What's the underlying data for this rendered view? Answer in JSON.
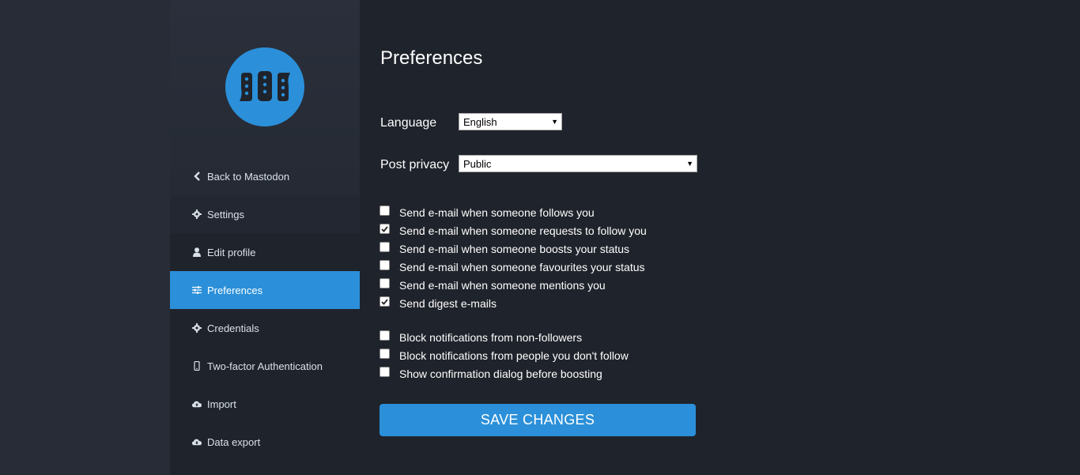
{
  "page": {
    "title": "Preferences"
  },
  "sidebar": {
    "logo_icon": "mastodon-logo-icon",
    "items": [
      {
        "label": "Back to Mastodon",
        "icon": "chevron-left-icon",
        "active": false
      },
      {
        "label": "Settings",
        "icon": "gear-icon",
        "active": false
      },
      {
        "label": "Edit profile",
        "icon": "user-icon",
        "active": false
      },
      {
        "label": "Preferences",
        "icon": "sliders-icon",
        "active": true
      },
      {
        "label": "Credentials",
        "icon": "gear-icon",
        "active": false
      },
      {
        "label": "Two-factor Authentication",
        "icon": "mobile-icon",
        "active": false
      },
      {
        "label": "Import",
        "icon": "cloud-upload-icon",
        "active": false
      },
      {
        "label": "Data export",
        "icon": "cloud-download-icon",
        "active": false
      }
    ]
  },
  "form": {
    "language": {
      "label": "Language",
      "value": "English"
    },
    "post_privacy": {
      "label": "Post privacy",
      "value": "Public"
    },
    "email_checks": [
      {
        "label": "Send e-mail when someone follows you",
        "checked": false
      },
      {
        "label": "Send e-mail when someone requests to follow you",
        "checked": true
      },
      {
        "label": "Send e-mail when someone boosts your status",
        "checked": false
      },
      {
        "label": "Send e-mail when someone favourites your status",
        "checked": false
      },
      {
        "label": "Send e-mail when someone mentions you",
        "checked": false
      },
      {
        "label": "Send digest e-mails",
        "checked": true
      }
    ],
    "other_checks": [
      {
        "label": "Block notifications from non-followers",
        "checked": false
      },
      {
        "label": "Block notifications from people you don't follow",
        "checked": false
      },
      {
        "label": "Show confirmation dialog before boosting",
        "checked": false
      }
    ],
    "save_label": "SAVE CHANGES"
  },
  "colors": {
    "accent": "#2b90d9",
    "sidebar_bg": "#282c37",
    "content_bg": "#1f232b"
  }
}
